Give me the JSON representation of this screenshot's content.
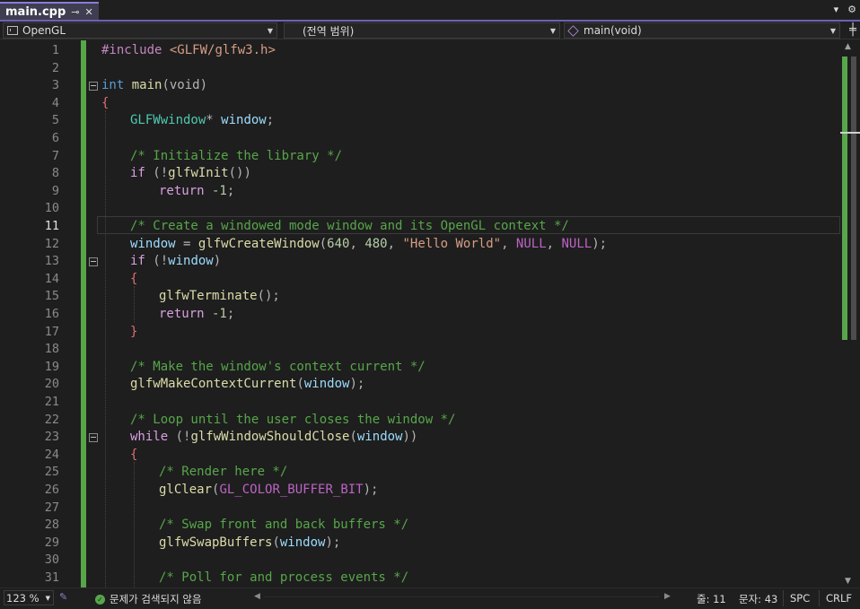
{
  "tab": {
    "title": "main.cpp",
    "pin_glyph": "⊸",
    "close_glyph": "✕"
  },
  "window_controls": {
    "dropdown_glyph": "▾",
    "settings_glyph": "⚙"
  },
  "navbar": {
    "project": "OpenGL",
    "scope": "(전역 범위)",
    "member": "main(void)",
    "split_glyph": "╪"
  },
  "editor": {
    "current_line": 11,
    "lines": [
      {
        "n": "1"
      },
      {
        "n": "2"
      },
      {
        "n": "3"
      },
      {
        "n": "4"
      },
      {
        "n": "5"
      },
      {
        "n": "6"
      },
      {
        "n": "7"
      },
      {
        "n": "8"
      },
      {
        "n": "9"
      },
      {
        "n": "10"
      },
      {
        "n": "11"
      },
      {
        "n": "12"
      },
      {
        "n": "13"
      },
      {
        "n": "14"
      },
      {
        "n": "15"
      },
      {
        "n": "16"
      },
      {
        "n": "17"
      },
      {
        "n": "18"
      },
      {
        "n": "19"
      },
      {
        "n": "20"
      },
      {
        "n": "21"
      },
      {
        "n": "22"
      },
      {
        "n": "23"
      },
      {
        "n": "24"
      },
      {
        "n": "25"
      },
      {
        "n": "26"
      },
      {
        "n": "27"
      },
      {
        "n": "28"
      },
      {
        "n": "29"
      },
      {
        "n": "30"
      },
      {
        "n": "31"
      }
    ],
    "code": {
      "l1": [
        "#include",
        " <GLFW/glfw3.h>"
      ],
      "l3": [
        "int",
        " main",
        "(void)"
      ],
      "l4": [
        "{"
      ],
      "l5": [
        "GLFWwindow",
        "*",
        " window",
        ";"
      ],
      "l7": [
        "/* Initialize the library */"
      ],
      "l8": [
        "if",
        " (!",
        "glfwInit",
        "())"
      ],
      "l9": [
        "return",
        " -1",
        ";"
      ],
      "l11": [
        "/* Create a windowed mode window and its OpenGL context */"
      ],
      "l12": [
        "window",
        " = ",
        "glfwCreateWindow",
        "(",
        "640",
        ", ",
        "480",
        ", ",
        "\"Hello World\"",
        ", ",
        "NULL",
        ", ",
        "NULL",
        ");"
      ],
      "l13": [
        "if",
        " (!",
        "window",
        ")"
      ],
      "l14": [
        "{"
      ],
      "l15": [
        "glfwTerminate",
        "();"
      ],
      "l16": [
        "return",
        " -1",
        ";"
      ],
      "l17": [
        "}"
      ],
      "l19": [
        "/* Make the window's context current */"
      ],
      "l20": [
        "glfwMakeContextCurrent",
        "(",
        "window",
        ");"
      ],
      "l22": [
        "/* Loop until the user closes the window */"
      ],
      "l23": [
        "while",
        " (!",
        "glfwWindowShouldClose",
        "(",
        "window",
        "))"
      ],
      "l24": [
        "{"
      ],
      "l25": [
        "/* Render here */"
      ],
      "l26": [
        "glClear",
        "(",
        "GL_COLOR_BUFFER_BIT",
        ");"
      ],
      "l28": [
        "/* Swap front and back buffers */"
      ],
      "l29": [
        "glfwSwapBuffers",
        "(",
        "window",
        ");"
      ],
      "l31": [
        "/* Poll for and process events */"
      ]
    }
  },
  "scrollbar": {
    "up_glyph": "▲",
    "down_glyph": "▼"
  },
  "statusbar": {
    "zoom": "123 %",
    "issues": "문제가 검색되지 않음",
    "line": "줄: 11",
    "column": "문자: 43",
    "whitespace": "SPC",
    "line_ending": "CRLF",
    "scroll_left_glyph": "◀",
    "scroll_right_glyph": "▶"
  },
  "colors": {
    "accent": "#6f5fb8",
    "change_bar": "#57a64a",
    "keyword": "#569cd6",
    "comment": "#57a64a",
    "function": "#dcdcaa",
    "type": "#4ec9b0",
    "variable": "#9cdcfe",
    "string": "#d69d85",
    "number": "#b5cea8",
    "macro": "#bd63c5"
  }
}
